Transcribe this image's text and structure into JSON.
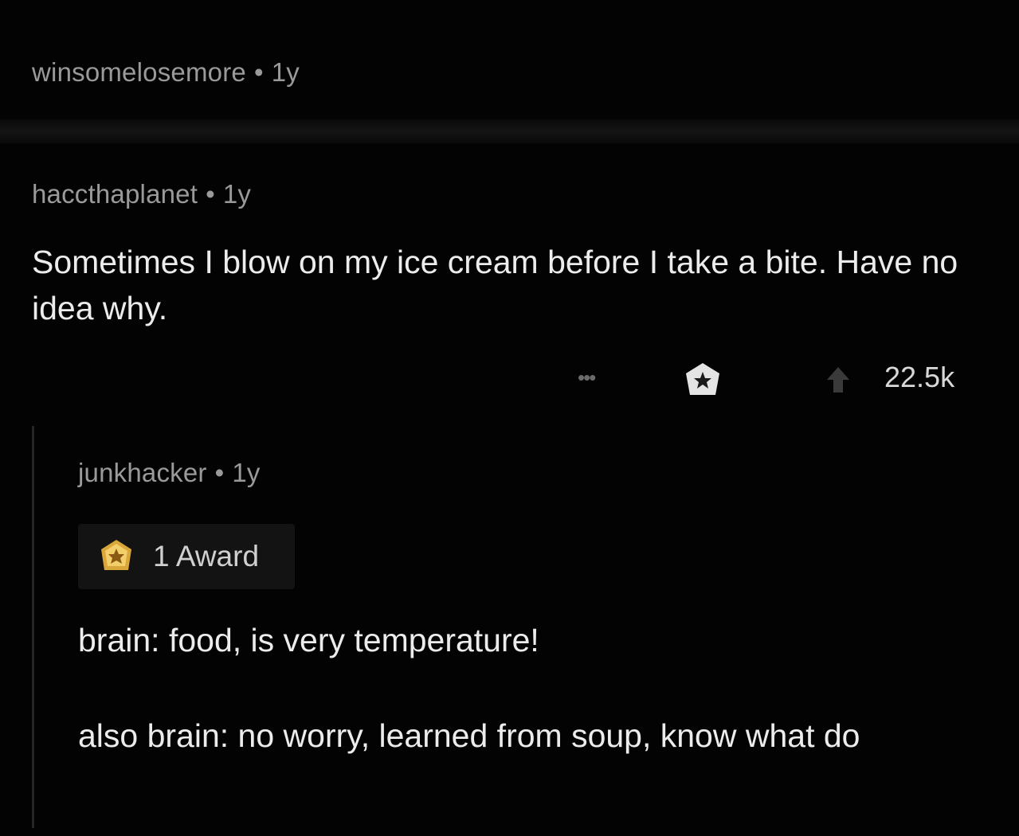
{
  "parent_comment": {
    "username": "winsomelosemore",
    "separator": "•",
    "age": "1y"
  },
  "comment": {
    "username": "haccthaplanet",
    "separator": "•",
    "age": "1y",
    "body": "Sometimes I blow on my ice cream before I take a bite. Have no idea why.",
    "actions": {
      "more_label": "•••",
      "award_icon": "award-icon",
      "upvote_icon": "upvote-arrow-icon",
      "score": "22.5k"
    }
  },
  "reply": {
    "username": "junkhacker",
    "separator": "•",
    "age": "1y",
    "award_label": "1 Award",
    "body_lines": [
      "brain: food, is very temperature!",
      "also brain: no worry, learned from soup, know what do"
    ]
  },
  "colors": {
    "background": "#030303",
    "meta_text": "#9a9a9a",
    "body_text": "#ececec",
    "award_gold": "#e0b040"
  }
}
